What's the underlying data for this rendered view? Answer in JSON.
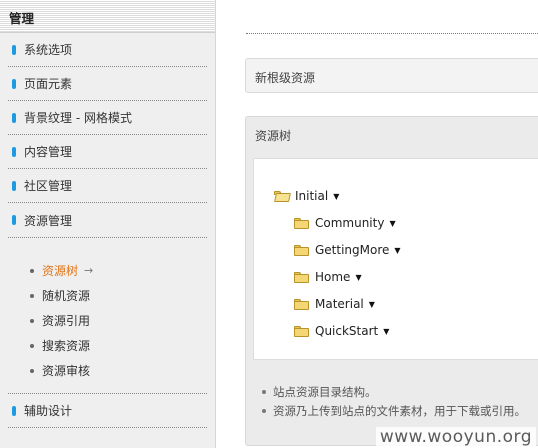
{
  "sidebar": {
    "title": "管理",
    "items_top": [
      {
        "label": "系统选项"
      },
      {
        "label": "页面元素"
      },
      {
        "label": "背景纹理 - 网格模式"
      },
      {
        "label": "内容管理"
      },
      {
        "label": "社区管理"
      },
      {
        "label": "资源管理"
      }
    ],
    "sub_items": [
      {
        "label": "资源树",
        "active": true
      },
      {
        "label": "随机资源"
      },
      {
        "label": "资源引用"
      },
      {
        "label": "搜索资源"
      },
      {
        "label": "资源审核"
      }
    ],
    "items_bottom": [
      {
        "label": "辅助设计"
      }
    ]
  },
  "main": {
    "new_root_label": "新根级资源",
    "panel_title": "资源树",
    "tree": {
      "root": "Initial",
      "children": [
        "Community",
        "GettingMore",
        "Home",
        "Material",
        "QuickStart"
      ]
    },
    "notes": [
      "站点资源目录结构。",
      "资源乃上传到站点的文件素材，用于下载或引用。"
    ]
  },
  "watermark": "www.wooyun.org",
  "colors": {
    "accent_bar": "#1e9be0",
    "active_link": "#e2761a"
  }
}
